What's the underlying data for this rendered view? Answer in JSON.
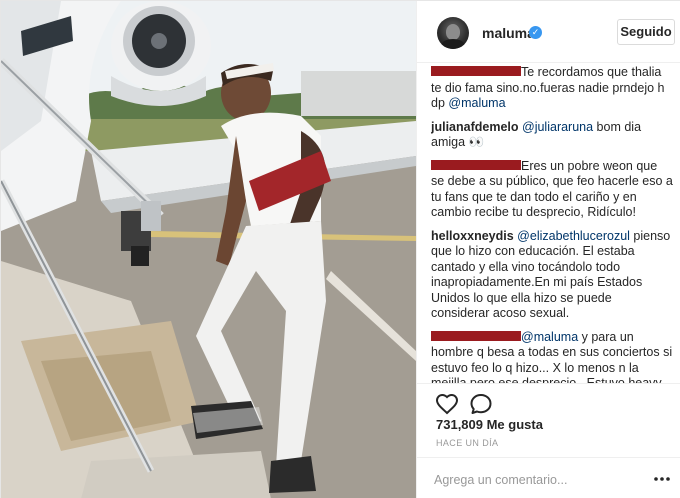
{
  "post": {
    "username": "maluma",
    "verified_glyph": "✓",
    "follow_label": "Seguido",
    "icons": {
      "verified": "verified-badge-icon",
      "like": "heart-icon",
      "comment": "comment-icon",
      "more": "more-options-icon"
    },
    "comments": [
      {
        "user": "",
        "redacted": true,
        "parts": [
          {
            "type": "text",
            "value": "Te recordamos que thalia te dio fama sino.no.fueras nadie prndejo h dp "
          },
          {
            "type": "mention",
            "value": "@maluma"
          }
        ]
      },
      {
        "user": "julianafdemelo",
        "redacted": false,
        "parts": [
          {
            "type": "mention",
            "value": "@juliararuna"
          },
          {
            "type": "text",
            "value": " bom dia amiga 👀"
          }
        ]
      },
      {
        "user": "",
        "redacted": true,
        "parts": [
          {
            "type": "text",
            "value": "Eres un pobre weon que se debe a su público, que feo hacerle eso a tu fans que te dan todo el cariño y en cambio recibe tu desprecio, Ridículo!"
          }
        ]
      },
      {
        "user": "helloxxneydis",
        "redacted": false,
        "parts": [
          {
            "type": "mention",
            "value": "@elizabethlucerozul"
          },
          {
            "type": "text",
            "value": " pienso que lo hizo con educación. El estaba cantado y ella vino tocándolo todo inapropiadamente.En mi país Estados Unidos lo que ella hizo se puede considerar acoso sexual."
          }
        ]
      },
      {
        "user": "",
        "redacted": true,
        "parts": [
          {
            "type": "mention",
            "value": "@maluma"
          },
          {
            "type": "text",
            "value": " y para un hombre q besa a todas en sus conciertos si estuvo feo lo q hizo... X lo menos n la mejilla pero ese desprecio.. Estuvo heavy.. 😒😳😱"
          }
        ]
      },
      {
        "user": "",
        "redacted": true,
        "cut": true,
        "parts": [
          {
            "type": "text",
            "value": "😡😡😡😡😡"
          }
        ]
      }
    ],
    "likes_text": "731,809 Me gusta",
    "time_text": "HACE UN DÍA",
    "comment_placeholder": "Agrega un comentario..."
  }
}
